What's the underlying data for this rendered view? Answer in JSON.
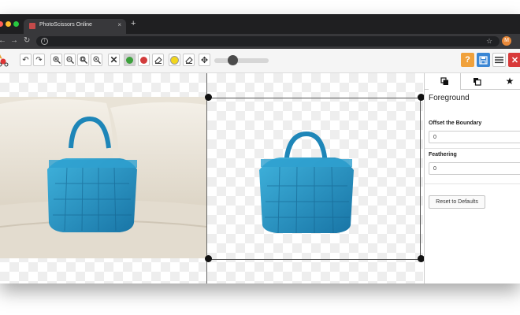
{
  "browser": {
    "tab_title": "PhotoScissors Online",
    "tab_close": "×",
    "new_tab": "+",
    "profile_initial": "M"
  },
  "toolbar": {
    "buttons": [
      "undo-icon",
      "redo-icon",
      "zoom-in-icon",
      "zoom-out-icon",
      "zoom-actual-icon",
      "zoom-fit-icon",
      "clear-icon",
      "foreground-marker-icon",
      "background-marker-icon",
      "eraser-icon",
      "color-picker-icon",
      "hair-eraser-icon",
      "move-icon"
    ],
    "slider_level": 0.25,
    "help_label": "?",
    "colors": {
      "help": "#f0a13b",
      "save": "#3a86d4",
      "close": "#d83a3a",
      "foreground": "#3ca03c",
      "background": "#d23c3c",
      "yellow": "#f2d61c"
    }
  },
  "panel": {
    "tabs": [
      "foreground-tab",
      "background-tab",
      "favorites-tab"
    ],
    "title": "Foreground",
    "offset_label": "Offset the Boundary",
    "offset_value": "0",
    "feathering_label": "Feathering",
    "feathering_value": "0",
    "reset_label": "Reset to Defaults"
  },
  "bag_color": "#1f8fc0"
}
